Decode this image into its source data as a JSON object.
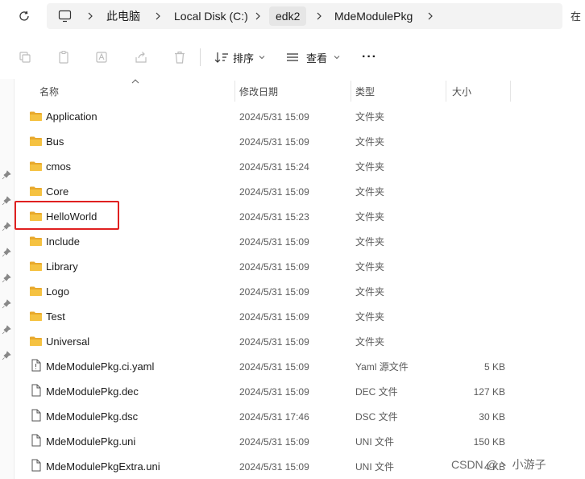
{
  "address": {
    "crumbs": [
      "此电脑",
      "Local Disk (C:)",
      "edk2",
      "MdeModulePkg"
    ],
    "right_edge_text": "在"
  },
  "toolbar": {
    "sort_label": "排序",
    "view_label": "查看",
    "more_label": "···"
  },
  "columns": {
    "name": "名称",
    "date": "修改日期",
    "type": "类型",
    "size": "大小"
  },
  "files": [
    {
      "name": "Application",
      "date": "2024/5/31 15:09",
      "type": "文件夹",
      "size": "",
      "kind": "folder"
    },
    {
      "name": "Bus",
      "date": "2024/5/31 15:09",
      "type": "文件夹",
      "size": "",
      "kind": "folder"
    },
    {
      "name": "cmos",
      "date": "2024/5/31 15:24",
      "type": "文件夹",
      "size": "",
      "kind": "folder"
    },
    {
      "name": "Core",
      "date": "2024/5/31 15:09",
      "type": "文件夹",
      "size": "",
      "kind": "folder"
    },
    {
      "name": "HelloWorld",
      "date": "2024/5/31 15:23",
      "type": "文件夹",
      "size": "",
      "kind": "folder"
    },
    {
      "name": "Include",
      "date": "2024/5/31 15:09",
      "type": "文件夹",
      "size": "",
      "kind": "folder"
    },
    {
      "name": "Library",
      "date": "2024/5/31 15:09",
      "type": "文件夹",
      "size": "",
      "kind": "folder"
    },
    {
      "name": "Logo",
      "date": "2024/5/31 15:09",
      "type": "文件夹",
      "size": "",
      "kind": "folder"
    },
    {
      "name": "Test",
      "date": "2024/5/31 15:09",
      "type": "文件夹",
      "size": "",
      "kind": "folder"
    },
    {
      "name": "Universal",
      "date": "2024/5/31 15:09",
      "type": "文件夹",
      "size": "",
      "kind": "folder"
    },
    {
      "name": "MdeModulePkg.ci.yaml",
      "date": "2024/5/31 15:09",
      "type": "Yaml 源文件",
      "size": "5 KB",
      "kind": "yaml"
    },
    {
      "name": "MdeModulePkg.dec",
      "date": "2024/5/31 15:09",
      "type": "DEC 文件",
      "size": "127 KB",
      "kind": "file"
    },
    {
      "name": "MdeModulePkg.dsc",
      "date": "2024/5/31 17:46",
      "type": "DSC 文件",
      "size": "30 KB",
      "kind": "file"
    },
    {
      "name": "MdeModulePkg.uni",
      "date": "2024/5/31 15:09",
      "type": "UNI 文件",
      "size": "150 KB",
      "kind": "file"
    },
    {
      "name": "MdeModulePkgExtra.uni",
      "date": "2024/5/31 15:09",
      "type": "UNI 文件",
      "size": "4 KB",
      "kind": "file"
    }
  ],
  "watermark": "CSDN @丶 小游子",
  "colors": {
    "folder": "#f5c242",
    "highlight": "#e02020",
    "accent": "#0067c0"
  },
  "icons": {
    "refresh": "refresh-icon",
    "pc": "computer-icon",
    "folder": "folder-icon",
    "file": "file-icon"
  }
}
